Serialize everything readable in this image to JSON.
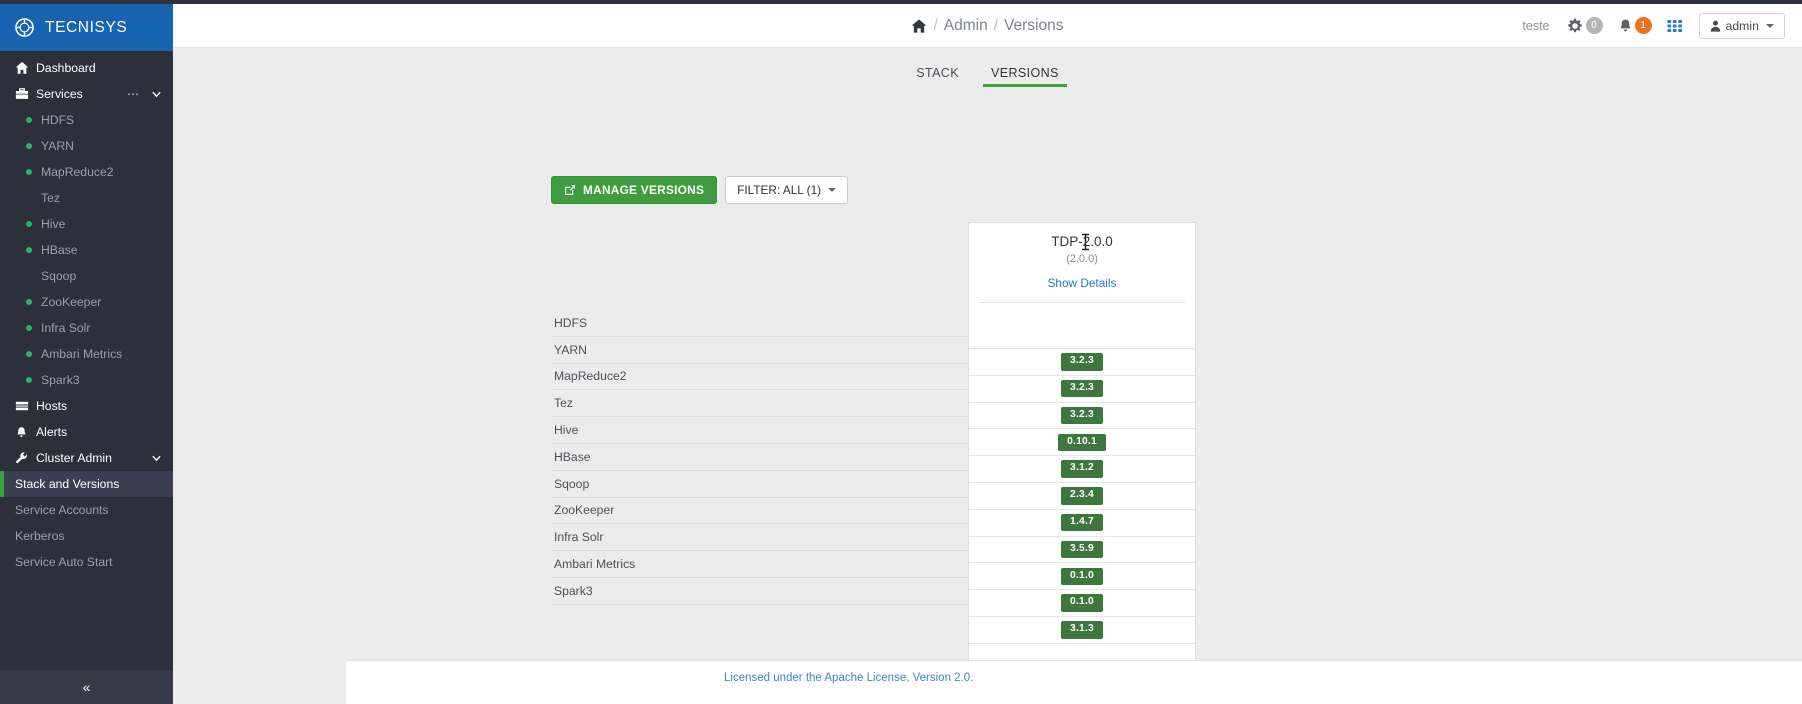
{
  "brand": {
    "name": "TECNISYS",
    "logo_icon": "compass-logo-icon"
  },
  "sidebar": {
    "dashboard": {
      "label": "Dashboard",
      "icon": "home-icon"
    },
    "services": {
      "label": "Services",
      "icon": "briefcase-icon",
      "more_icon": "ellipsis-icon",
      "caret_icon": "chevron-down-icon"
    },
    "services_items": [
      {
        "label": "HDFS",
        "status": "green"
      },
      {
        "label": "YARN",
        "status": "green"
      },
      {
        "label": "MapReduce2",
        "status": "green"
      },
      {
        "label": "Tez",
        "status": "none"
      },
      {
        "label": "Hive",
        "status": "green"
      },
      {
        "label": "HBase",
        "status": "green"
      },
      {
        "label": "Sqoop",
        "status": "none"
      },
      {
        "label": "ZooKeeper",
        "status": "green"
      },
      {
        "label": "Infra Solr",
        "status": "green"
      },
      {
        "label": "Ambari Metrics",
        "status": "green"
      },
      {
        "label": "Spark3",
        "status": "green"
      }
    ],
    "hosts": {
      "label": "Hosts",
      "icon": "server-icon"
    },
    "alerts": {
      "label": "Alerts",
      "icon": "bell-icon"
    },
    "cluster_admin": {
      "label": "Cluster Admin",
      "icon": "wrench-icon",
      "caret_icon": "chevron-down-icon"
    },
    "admin_items": [
      {
        "label": "Stack and Versions",
        "active": true
      },
      {
        "label": "Service Accounts",
        "active": false
      },
      {
        "label": "Kerberos",
        "active": false
      },
      {
        "label": "Service Auto Start",
        "active": false
      }
    ],
    "collapse": {
      "icon": "double-chevron-left-icon",
      "glyph": "«"
    }
  },
  "topbar": {
    "home_icon": "home-icon",
    "breadcrumb": [
      "Admin",
      "Versions"
    ],
    "separator": "/",
    "cluster_name": "teste",
    "gear_icon": "gear-icon",
    "gear_count": "0",
    "bell_icon": "bell-icon",
    "bell_count": "1",
    "grid_icon": "grid-apps-icon",
    "user_icon": "user-icon",
    "user_label": "admin",
    "caret_icon": "caret-down-icon"
  },
  "tabs": [
    {
      "label": "STACK",
      "active": false
    },
    {
      "label": "VERSIONS",
      "active": true
    }
  ],
  "actions": {
    "manage_versions": {
      "label": "MANAGE VERSIONS",
      "icon": "external-link-icon"
    },
    "filter": {
      "label": "FILTER: ALL (1)",
      "icon": "caret-down-icon"
    }
  },
  "version_card": {
    "title": "TDP-2.0.0",
    "subtitle": "(2.0.0)",
    "details_link": "Show Details",
    "cursor_icon": "text-ibeam-cursor"
  },
  "table": {
    "rows": [
      {
        "service": "HDFS",
        "version": "3.2.3"
      },
      {
        "service": "YARN",
        "version": "3.2.3"
      },
      {
        "service": "MapReduce2",
        "version": "3.2.3"
      },
      {
        "service": "Tez",
        "version": "0.10.1"
      },
      {
        "service": "Hive",
        "version": "3.1.2"
      },
      {
        "service": "HBase",
        "version": "2.3.4"
      },
      {
        "service": "Sqoop",
        "version": "1.4.7"
      },
      {
        "service": "ZooKeeper",
        "version": "3.5.9"
      },
      {
        "service": "Infra Solr",
        "version": "0.1.0"
      },
      {
        "service": "Ambari Metrics",
        "version": "0.1.0"
      },
      {
        "service": "Spark3",
        "version": "3.1.3"
      }
    ]
  },
  "footer": {
    "license_line": "Licensed under the Apache License, Version 2.0."
  },
  "colors": {
    "sidebar_bg": "#2b303b",
    "brand_bg": "#1565b5",
    "accent_green": "#39a33d",
    "badge_green": "#3e773d",
    "link_blue": "#1e7cc4",
    "status_dot": "#22b573",
    "alert_orange": "#ef7120"
  }
}
